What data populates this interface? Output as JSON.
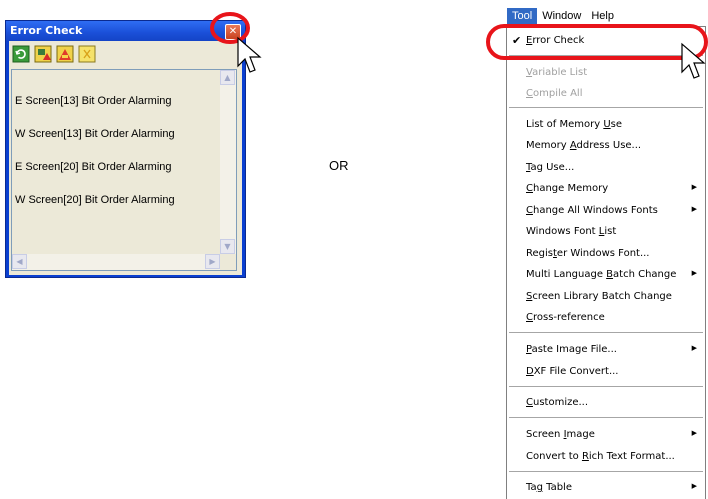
{
  "error_check_window": {
    "title": "Error Check",
    "close_glyph": "✕",
    "toolbar_icons": [
      "refresh-icon",
      "error-filter-icon",
      "warning-filter-icon",
      "info-filter-icon"
    ],
    "lines": [
      "E Screen[13] Bit Order Alarming",
      "W Screen[13] Bit Order Alarming",
      "E Screen[20] Bit Order Alarming",
      "W Screen[20] Bit Order Alarming"
    ]
  },
  "separator_text": "OR",
  "menubar": {
    "items": [
      "Tool",
      "Window",
      "Help"
    ],
    "active": "Tool"
  },
  "menu": {
    "items": [
      {
        "label": "Error Check",
        "mnemonic": "E",
        "checked": true
      },
      {
        "label": "Variable List",
        "mnemonic": "V",
        "disabled": true
      },
      {
        "label": "Compile All",
        "mnemonic": "C",
        "disabled": true
      },
      {
        "label": "List of Memory Use",
        "mnemonic": "U"
      },
      {
        "label": "Memory Address Use...",
        "mnemonic": "A"
      },
      {
        "label": "Tag Use...",
        "mnemonic": "T"
      },
      {
        "label": "Change Memory",
        "mnemonic": "C",
        "submenu": true
      },
      {
        "label": "Change All Windows Fonts",
        "mnemonic": "C",
        "submenu": true
      },
      {
        "label": "Windows Font List",
        "mnemonic": "L"
      },
      {
        "label": "Register Windows Font...",
        "mnemonic": "t"
      },
      {
        "label": "Multi Language Batch Change",
        "mnemonic": "B",
        "submenu": true
      },
      {
        "label": "Screen Library Batch Change",
        "mnemonic": "S"
      },
      {
        "label": "Cross-reference",
        "mnemonic": "C"
      },
      {
        "label": "Paste Image File...",
        "mnemonic": "P",
        "submenu": true
      },
      {
        "label": "DXF File Convert...",
        "mnemonic": "D"
      },
      {
        "label": "Customize...",
        "mnemonic": "C"
      },
      {
        "label": "Screen Image",
        "mnemonic": "I",
        "submenu": true
      },
      {
        "label": "Convert to Rich Text Format...",
        "mnemonic": "R"
      },
      {
        "label": "Tag Table",
        "mnemonic": "g",
        "submenu": true
      }
    ]
  },
  "colors": {
    "annotation_red": "#e8141a",
    "menu_highlight": "#316ac5",
    "xp_title_blue": "#1a4fd8"
  }
}
